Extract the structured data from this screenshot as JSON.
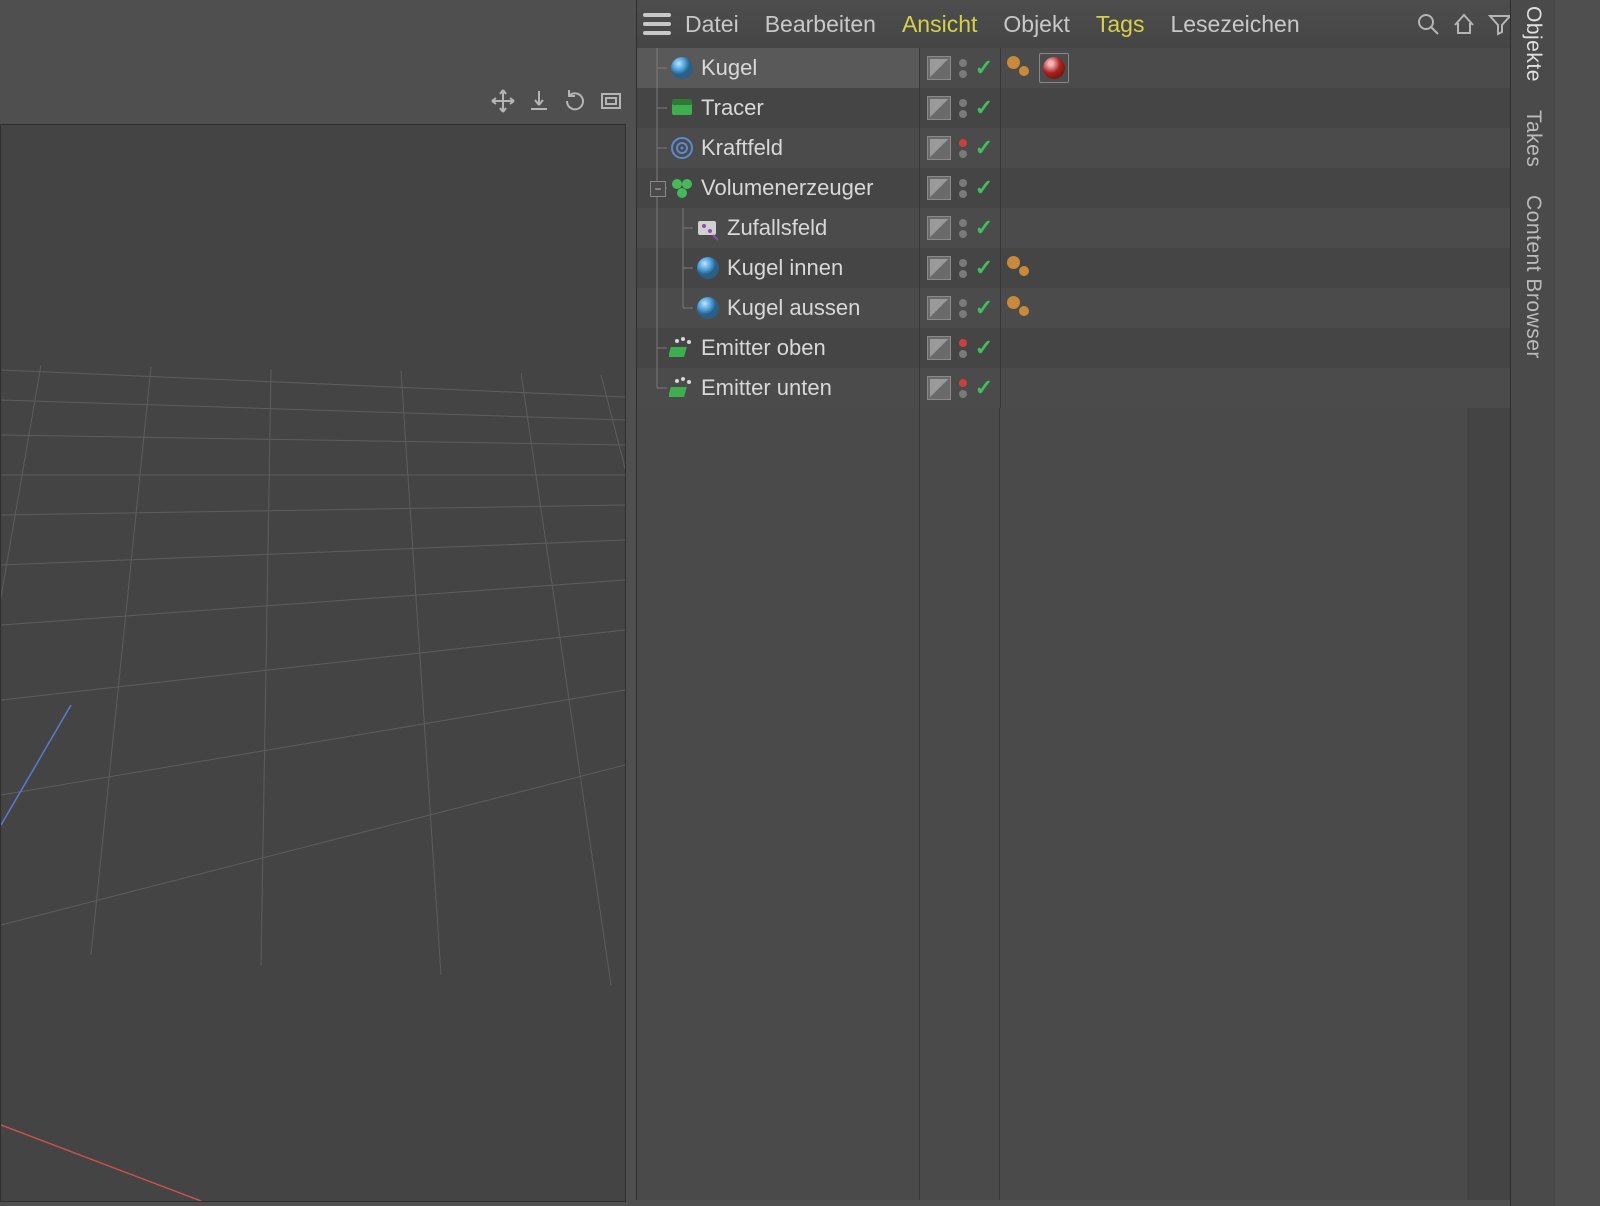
{
  "menus": {
    "file": "Datei",
    "edit": "Bearbeiten",
    "view": "Ansicht",
    "object": "Objekt",
    "tags": "Tags",
    "bookmarks": "Lesezeichen"
  },
  "side_tabs": {
    "objects": "Objekte",
    "takes": "Takes",
    "content_browser": "Content Browser"
  },
  "tree": [
    {
      "name": "Kugel",
      "depth": 0,
      "icon": "sphere",
      "dot_top": "gray",
      "tags": [
        "dyn",
        "mat"
      ],
      "selected": true
    },
    {
      "name": "Tracer",
      "depth": 0,
      "icon": "tracer",
      "dot_top": "gray",
      "tags": []
    },
    {
      "name": "Kraftfeld",
      "depth": 0,
      "icon": "force",
      "dot_top": "red",
      "tags": []
    },
    {
      "name": "Volumenerzeuger",
      "depth": 0,
      "icon": "volume",
      "dot_top": "gray",
      "tags": [],
      "expand": "minus"
    },
    {
      "name": "Zufallsfeld",
      "depth": 1,
      "icon": "random",
      "dot_top": "gray",
      "tags": []
    },
    {
      "name": "Kugel innen",
      "depth": 1,
      "icon": "sphere",
      "dot_top": "gray",
      "tags": [
        "dyn"
      ]
    },
    {
      "name": "Kugel aussen",
      "depth": 1,
      "icon": "sphere",
      "dot_top": "gray",
      "tags": [
        "dyn"
      ]
    },
    {
      "name": "Emitter oben",
      "depth": 0,
      "icon": "emitter",
      "dot_top": "red",
      "tags": []
    },
    {
      "name": "Emitter unten",
      "depth": 0,
      "icon": "emitter",
      "dot_top": "red",
      "tags": []
    }
  ]
}
